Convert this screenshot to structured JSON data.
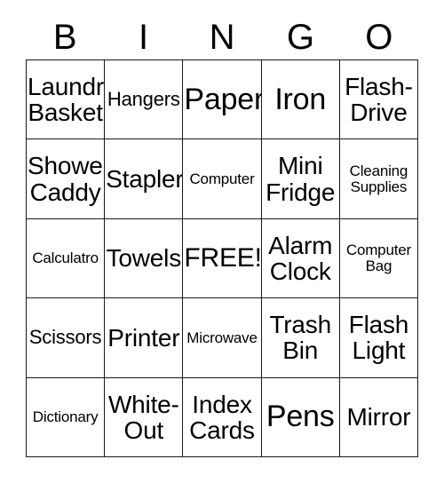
{
  "card": {
    "headers": [
      "B",
      "I",
      "N",
      "G",
      "O"
    ],
    "free_space_label": "FREE!",
    "border_color": "#1a1a1a",
    "background_color": "#ffffff",
    "text_color": "#000000",
    "rows": [
      [
        {
          "label": "Laundry\nBasket",
          "size": "md"
        },
        {
          "label": "Hangers",
          "size": "sm"
        },
        {
          "label": "Paper",
          "size": "xl"
        },
        {
          "label": "Iron",
          "size": "xl"
        },
        {
          "label": "Flash-\nDrive",
          "size": "md"
        }
      ],
      [
        {
          "label": "Shower\nCaddy",
          "size": "md"
        },
        {
          "label": "Stapler",
          "size": "md"
        },
        {
          "label": "Computer",
          "size": "xs"
        },
        {
          "label": "Mini\nFridge",
          "size": "md"
        },
        {
          "label": "Cleaning\nSupplies",
          "size": "xs"
        }
      ],
      [
        {
          "label": "Calculatro",
          "size": "xs"
        },
        {
          "label": "Towels",
          "size": "md"
        },
        {
          "label": "FREE!",
          "size": "lg"
        },
        {
          "label": "Alarm\nClock",
          "size": "md"
        },
        {
          "label": "Computer\nBag",
          "size": "xs"
        }
      ],
      [
        {
          "label": "Scissors",
          "size": "sm"
        },
        {
          "label": "Printer",
          "size": "md"
        },
        {
          "label": "Microwave",
          "size": "xs"
        },
        {
          "label": "Trash\nBin",
          "size": "md"
        },
        {
          "label": "Flash\nLight",
          "size": "md"
        }
      ],
      [
        {
          "label": "Dictionary",
          "size": "xs"
        },
        {
          "label": "White-\nOut",
          "size": "md"
        },
        {
          "label": "Index\nCards",
          "size": "md"
        },
        {
          "label": "Pens",
          "size": "xl"
        },
        {
          "label": "Mirror",
          "size": "md"
        }
      ]
    ]
  }
}
